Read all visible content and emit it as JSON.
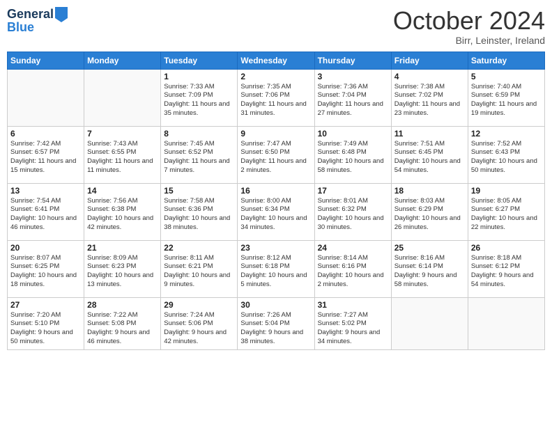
{
  "header": {
    "logo_line1": "General",
    "logo_line2": "Blue",
    "month_title": "October 2024",
    "location": "Birr, Leinster, Ireland"
  },
  "days_of_week": [
    "Sunday",
    "Monday",
    "Tuesday",
    "Wednesday",
    "Thursday",
    "Friday",
    "Saturday"
  ],
  "weeks": [
    [
      {
        "day": "",
        "info": ""
      },
      {
        "day": "",
        "info": ""
      },
      {
        "day": "1",
        "info": "Sunrise: 7:33 AM\nSunset: 7:09 PM\nDaylight: 11 hours\nand 35 minutes."
      },
      {
        "day": "2",
        "info": "Sunrise: 7:35 AM\nSunset: 7:06 PM\nDaylight: 11 hours\nand 31 minutes."
      },
      {
        "day": "3",
        "info": "Sunrise: 7:36 AM\nSunset: 7:04 PM\nDaylight: 11 hours\nand 27 minutes."
      },
      {
        "day": "4",
        "info": "Sunrise: 7:38 AM\nSunset: 7:02 PM\nDaylight: 11 hours\nand 23 minutes."
      },
      {
        "day": "5",
        "info": "Sunrise: 7:40 AM\nSunset: 6:59 PM\nDaylight: 11 hours\nand 19 minutes."
      }
    ],
    [
      {
        "day": "6",
        "info": "Sunrise: 7:42 AM\nSunset: 6:57 PM\nDaylight: 11 hours\nand 15 minutes."
      },
      {
        "day": "7",
        "info": "Sunrise: 7:43 AM\nSunset: 6:55 PM\nDaylight: 11 hours\nand 11 minutes."
      },
      {
        "day": "8",
        "info": "Sunrise: 7:45 AM\nSunset: 6:52 PM\nDaylight: 11 hours\nand 7 minutes."
      },
      {
        "day": "9",
        "info": "Sunrise: 7:47 AM\nSunset: 6:50 PM\nDaylight: 11 hours\nand 2 minutes."
      },
      {
        "day": "10",
        "info": "Sunrise: 7:49 AM\nSunset: 6:48 PM\nDaylight: 10 hours\nand 58 minutes."
      },
      {
        "day": "11",
        "info": "Sunrise: 7:51 AM\nSunset: 6:45 PM\nDaylight: 10 hours\nand 54 minutes."
      },
      {
        "day": "12",
        "info": "Sunrise: 7:52 AM\nSunset: 6:43 PM\nDaylight: 10 hours\nand 50 minutes."
      }
    ],
    [
      {
        "day": "13",
        "info": "Sunrise: 7:54 AM\nSunset: 6:41 PM\nDaylight: 10 hours\nand 46 minutes."
      },
      {
        "day": "14",
        "info": "Sunrise: 7:56 AM\nSunset: 6:38 PM\nDaylight: 10 hours\nand 42 minutes."
      },
      {
        "day": "15",
        "info": "Sunrise: 7:58 AM\nSunset: 6:36 PM\nDaylight: 10 hours\nand 38 minutes."
      },
      {
        "day": "16",
        "info": "Sunrise: 8:00 AM\nSunset: 6:34 PM\nDaylight: 10 hours\nand 34 minutes."
      },
      {
        "day": "17",
        "info": "Sunrise: 8:01 AM\nSunset: 6:32 PM\nDaylight: 10 hours\nand 30 minutes."
      },
      {
        "day": "18",
        "info": "Sunrise: 8:03 AM\nSunset: 6:29 PM\nDaylight: 10 hours\nand 26 minutes."
      },
      {
        "day": "19",
        "info": "Sunrise: 8:05 AM\nSunset: 6:27 PM\nDaylight: 10 hours\nand 22 minutes."
      }
    ],
    [
      {
        "day": "20",
        "info": "Sunrise: 8:07 AM\nSunset: 6:25 PM\nDaylight: 10 hours\nand 18 minutes."
      },
      {
        "day": "21",
        "info": "Sunrise: 8:09 AM\nSunset: 6:23 PM\nDaylight: 10 hours\nand 13 minutes."
      },
      {
        "day": "22",
        "info": "Sunrise: 8:11 AM\nSunset: 6:21 PM\nDaylight: 10 hours\nand 9 minutes."
      },
      {
        "day": "23",
        "info": "Sunrise: 8:12 AM\nSunset: 6:18 PM\nDaylight: 10 hours\nand 5 minutes."
      },
      {
        "day": "24",
        "info": "Sunrise: 8:14 AM\nSunset: 6:16 PM\nDaylight: 10 hours\nand 2 minutes."
      },
      {
        "day": "25",
        "info": "Sunrise: 8:16 AM\nSunset: 6:14 PM\nDaylight: 9 hours\nand 58 minutes."
      },
      {
        "day": "26",
        "info": "Sunrise: 8:18 AM\nSunset: 6:12 PM\nDaylight: 9 hours\nand 54 minutes."
      }
    ],
    [
      {
        "day": "27",
        "info": "Sunrise: 7:20 AM\nSunset: 5:10 PM\nDaylight: 9 hours\nand 50 minutes."
      },
      {
        "day": "28",
        "info": "Sunrise: 7:22 AM\nSunset: 5:08 PM\nDaylight: 9 hours\nand 46 minutes."
      },
      {
        "day": "29",
        "info": "Sunrise: 7:24 AM\nSunset: 5:06 PM\nDaylight: 9 hours\nand 42 minutes."
      },
      {
        "day": "30",
        "info": "Sunrise: 7:26 AM\nSunset: 5:04 PM\nDaylight: 9 hours\nand 38 minutes."
      },
      {
        "day": "31",
        "info": "Sunrise: 7:27 AM\nSunset: 5:02 PM\nDaylight: 9 hours\nand 34 minutes."
      },
      {
        "day": "",
        "info": ""
      },
      {
        "day": "",
        "info": ""
      }
    ]
  ]
}
